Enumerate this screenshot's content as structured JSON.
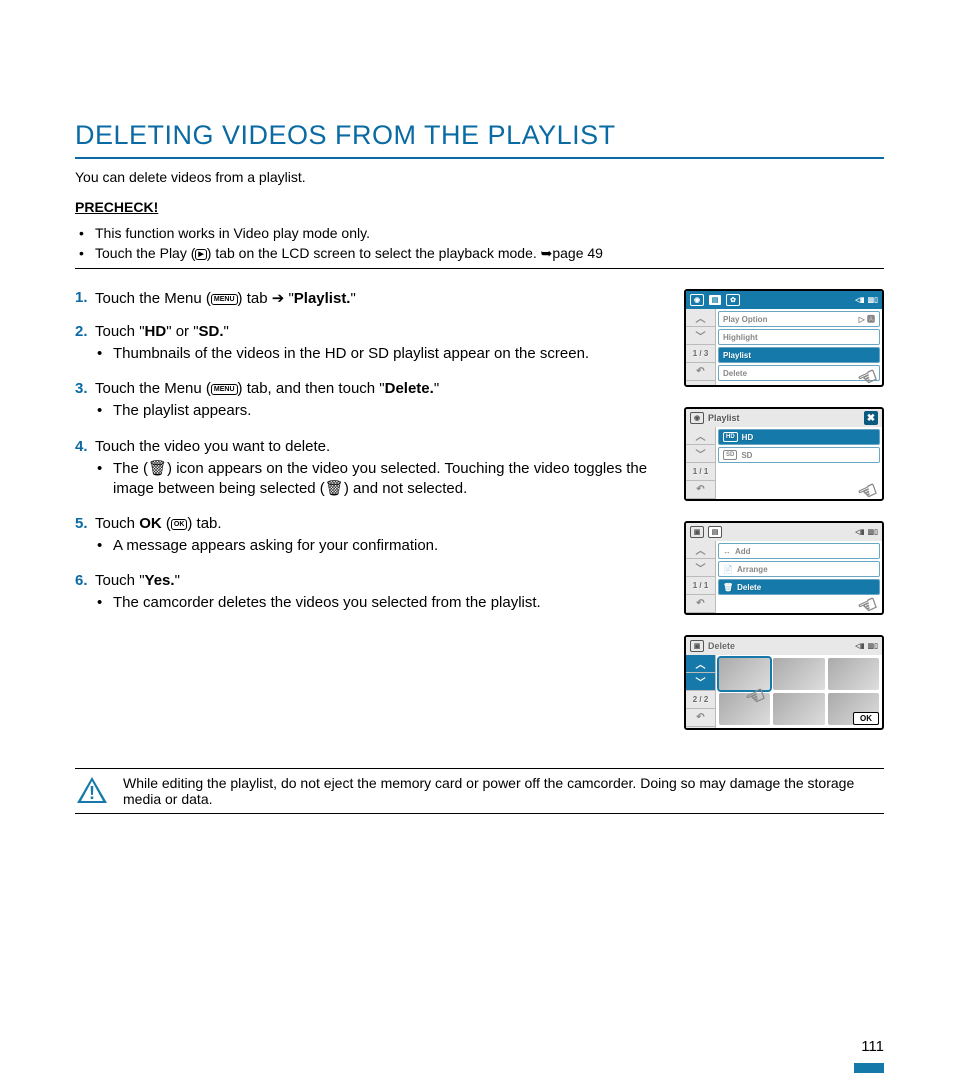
{
  "title": "DELETING VIDEOS FROM THE PLAYLIST",
  "subtitle": "You can delete videos from a playlist.",
  "precheck_heading": "PRECHECK!",
  "precheck": [
    {
      "pre": "This function works in Video play mode only.",
      "post": ""
    },
    {
      "pre": "Touch the Play (",
      "icon": "play",
      "post": ") tab on the LCD screen to select the playback mode. ➥page 49"
    }
  ],
  "steps": [
    {
      "num": "1.",
      "frags": [
        "Touch the Menu (",
        {
          "icon": "MENU"
        },
        ") tab ➔ \"",
        {
          "b": "Playlist."
        },
        "\""
      ],
      "bullets": []
    },
    {
      "num": "2.",
      "frags": [
        "Touch \"",
        {
          "b": "HD"
        },
        "\" or \"",
        {
          "b": "SD."
        },
        "\""
      ],
      "bullets": [
        "Thumbnails of the videos in the HD or SD playlist appear on the screen."
      ]
    },
    {
      "num": "3.",
      "frags": [
        "Touch the Menu (",
        {
          "icon": "MENU"
        },
        ") tab, and then touch \"",
        {
          "b": "Delete."
        },
        "\""
      ],
      "bullets": [
        "The playlist appears."
      ]
    },
    {
      "num": "4.",
      "frags": [
        "Touch the video you want to delete."
      ],
      "bullets": [
        "The (🗑) icon appears on the video you selected. Touching the video toggles the image between being selected (🗑) and not selected."
      ]
    },
    {
      "num": "5.",
      "frags": [
        "Touch ",
        {
          "b": "OK"
        },
        " (",
        {
          "icon": "OK"
        },
        ") tab."
      ],
      "bullets": [
        "A message appears asking for your confirmation."
      ]
    },
    {
      "num": "6.",
      "frags": [
        "Touch \"",
        {
          "b": "Yes."
        },
        "\""
      ],
      "bullets": [
        "The camcorder deletes the videos you selected from the playlist."
      ]
    }
  ],
  "screens": {
    "s1": {
      "pager": "1 / 3",
      "rows": [
        {
          "label": "Play Option",
          "active": false,
          "right": "▷ 🅰"
        },
        {
          "label": "Highlight",
          "active": false
        },
        {
          "label": "Playlist",
          "active": true
        },
        {
          "label": "Delete",
          "active": false
        }
      ]
    },
    "s2": {
      "title": "Playlist",
      "pager": "1 / 1",
      "rows": [
        {
          "badge": "HD",
          "label": "HD",
          "active": true
        },
        {
          "badge": "SD",
          "label": "SD",
          "active": false
        }
      ]
    },
    "s3": {
      "pager": "1 / 1",
      "rows": [
        {
          "icon": "↔",
          "label": "Add",
          "active": false
        },
        {
          "icon": "📄",
          "label": "Arrange",
          "active": false
        },
        {
          "icon": "🗑",
          "label": "Delete",
          "active": true
        }
      ]
    },
    "s4": {
      "title": "Delete",
      "pager": "2 / 2",
      "ok": "OK"
    }
  },
  "warning": "While editing the playlist, do not eject the memory card or power off the camcorder. Doing so may damage the storage media or data.",
  "page_number": "111"
}
